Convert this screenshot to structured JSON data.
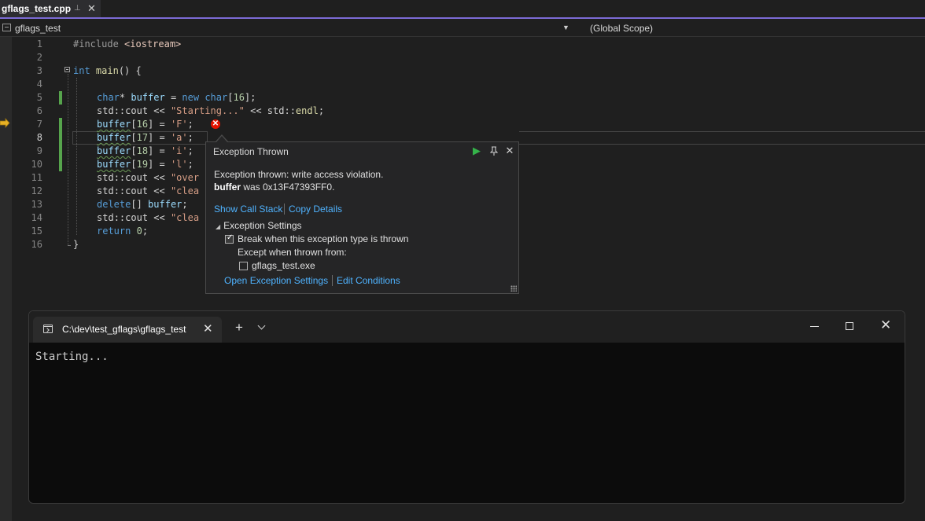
{
  "tab": {
    "title": "gflags_test.cpp",
    "pin_icon": "pin-icon",
    "close_icon": "close-icon"
  },
  "navbar": {
    "project": "gflags_test",
    "scope": "(Global Scope)"
  },
  "lines": [
    {
      "n": "1"
    },
    {
      "n": "2"
    },
    {
      "n": "3"
    },
    {
      "n": "4"
    },
    {
      "n": "5"
    },
    {
      "n": "6"
    },
    {
      "n": "7"
    },
    {
      "n": "8"
    },
    {
      "n": "9"
    },
    {
      "n": "10"
    },
    {
      "n": "11"
    },
    {
      "n": "12"
    },
    {
      "n": "13"
    },
    {
      "n": "14"
    },
    {
      "n": "15"
    },
    {
      "n": "16"
    }
  ],
  "code": {
    "l1_directive": "#include",
    "l1_header": "<iostream>",
    "l3_kw": "int",
    "l3_fn": "main",
    "l3_rest": "() {",
    "l5_kw": "char",
    "l5_a": "* ",
    "l5_var": "buffer",
    "l5_b": " = ",
    "l5_new": "new",
    "l5_c": " ",
    "l5_char": "char",
    "l5_d": "[",
    "l5_num": "16",
    "l5_e": "];",
    "l6_std": "std",
    "l6_a": "::",
    "l6_cout": "cout",
    "l6_b": " << ",
    "l6_str": "\"Starting...\"",
    "l6_c": " << ",
    "l6_std2": "std",
    "l6_d": "::",
    "l6_endl": "endl",
    "l6_e": ";",
    "l7_var": "buffer",
    "l7_a": "[",
    "l7_num": "16",
    "l7_b": "] = ",
    "l7_str": "'F'",
    "l7_c": ";",
    "l8_var": "buffer",
    "l8_a": "[",
    "l8_num": "17",
    "l8_b": "] = ",
    "l8_str": "'a'",
    "l8_c": ";",
    "l9_var": "buffer",
    "l9_a": "[",
    "l9_num": "18",
    "l9_b": "] = ",
    "l9_str": "'i'",
    "l9_c": ";",
    "l10_var": "buffer",
    "l10_a": "[",
    "l10_num": "19",
    "l10_b": "] = ",
    "l10_str": "'l'",
    "l10_c": ";",
    "l11_std": "std",
    "l11_a": "::",
    "l11_cout": "cout",
    "l11_b": " << ",
    "l11_str": "\"over",
    "l12_std": "std",
    "l12_a": "::",
    "l12_cout": "cout",
    "l12_b": " << ",
    "l12_str": "\"clea",
    "l13_kw": "delete",
    "l13_a": "[] ",
    "l13_var": "buffer",
    "l13_b": ";",
    "l14_std": "std",
    "l14_a": "::",
    "l14_cout": "cout",
    "l14_b": " << ",
    "l14_str": "\"clea",
    "l15_kw": "return",
    "l15_a": " ",
    "l15_num": "0",
    "l15_b": ";",
    "l16": "}"
  },
  "exception": {
    "title": "Exception Thrown",
    "message": "Exception thrown: write access violation.",
    "detail_bold": "buffer",
    "detail_rest": " was 0x13F47393FF0.",
    "show_call_stack": "Show Call Stack",
    "copy_details": "Copy Details",
    "settings_header": "Exception Settings",
    "break_when": "Break when this exception type is thrown",
    "break_when_checked": true,
    "except_when": "Except when thrown from:",
    "module": "gflags_test.exe",
    "module_checked": false,
    "open_settings": "Open Exception Settings",
    "edit_conditions": "Edit Conditions",
    "error_glyph": "✕"
  },
  "terminal": {
    "tab_title": "C:\\dev\\test_gflags\\gflags_test",
    "output": "Starting..."
  },
  "colors": {
    "accent": "#7c6bd6",
    "change_bar": "#56a44c",
    "link": "#4fb3ff",
    "error": "#e51400",
    "continue": "#35b34a"
  }
}
